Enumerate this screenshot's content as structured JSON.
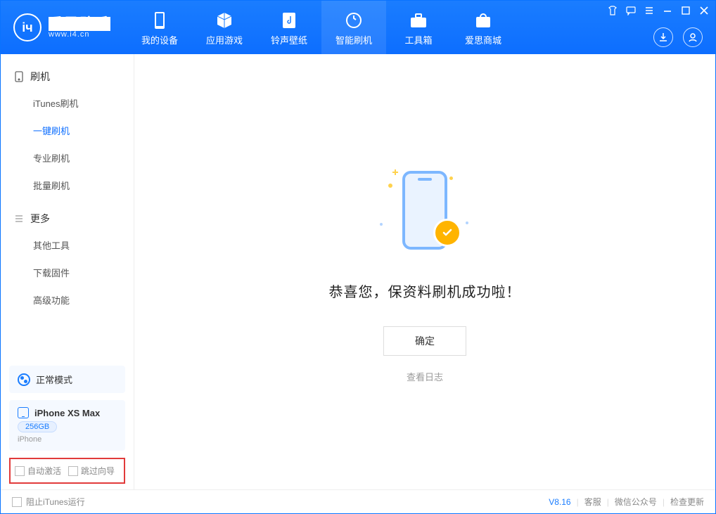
{
  "app": {
    "name": "爱思助手",
    "url": "www.i4.cn"
  },
  "nav": {
    "items": [
      {
        "label": "我的设备"
      },
      {
        "label": "应用游戏"
      },
      {
        "label": "铃声壁纸"
      },
      {
        "label": "智能刷机"
      },
      {
        "label": "工具箱"
      },
      {
        "label": "爱思商城"
      }
    ]
  },
  "sidebar": {
    "flash_header": "刷机",
    "flash_items": [
      {
        "label": "iTunes刷机"
      },
      {
        "label": "一键刷机"
      },
      {
        "label": "专业刷机"
      },
      {
        "label": "批量刷机"
      }
    ],
    "more_header": "更多",
    "more_items": [
      {
        "label": "其他工具"
      },
      {
        "label": "下载固件"
      },
      {
        "label": "高级功能"
      }
    ],
    "mode_label": "正常模式",
    "device_name": "iPhone XS Max",
    "device_storage": "256GB",
    "device_sub": "iPhone",
    "opt_auto_activate": "自动激活",
    "opt_skip_guide": "跳过向导"
  },
  "main": {
    "success_text": "恭喜您，保资料刷机成功啦！",
    "ok_button": "确定",
    "view_log": "查看日志"
  },
  "footer": {
    "block_itunes": "阻止iTunes运行",
    "version": "V8.16",
    "support": "客服",
    "wechat": "微信公众号",
    "update": "检查更新"
  }
}
